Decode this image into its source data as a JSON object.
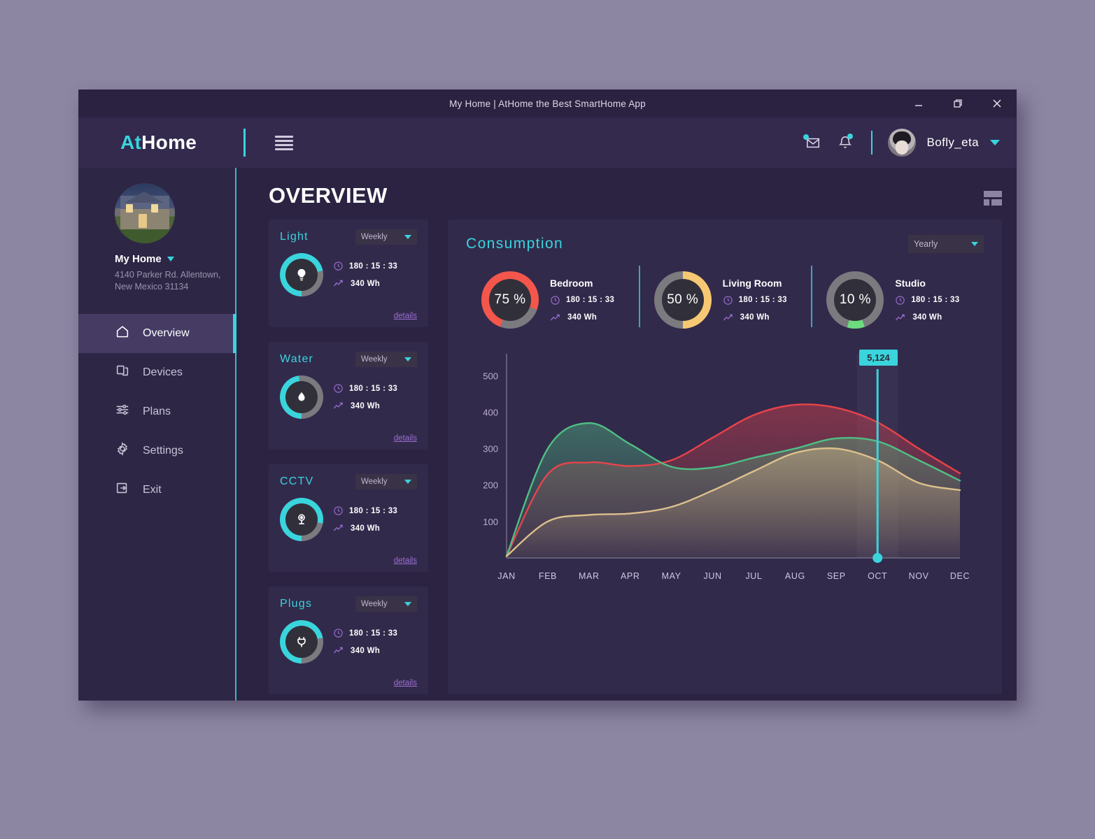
{
  "window": {
    "title": "My Home | AtHome the Best SmartHome App",
    "controls": [
      {
        "name": "minimize",
        "label": "—"
      },
      {
        "name": "restore",
        "label": "❐"
      },
      {
        "name": "close",
        "label": "✕"
      }
    ]
  },
  "header": {
    "logo_accent": "At",
    "logo_rest": "Home",
    "menu_icon": "hamburger-icon",
    "mail_icon": "mail-icon",
    "bell_icon": "bell-icon",
    "username": "Bofly_eta"
  },
  "sidebar": {
    "home_name": "My Home",
    "home_address": "4140 Parker Rd. Allentown, New Mexico 31134",
    "items": [
      {
        "label": "Overview",
        "icon": "home-icon",
        "active": true
      },
      {
        "label": "Devices",
        "icon": "devices-icon",
        "active": false
      },
      {
        "label": "Plans",
        "icon": "sliders-icon",
        "active": false
      },
      {
        "label": "Settings",
        "icon": "gear-icon",
        "active": false
      },
      {
        "label": "Exit",
        "icon": "exit-icon",
        "active": false
      }
    ]
  },
  "main": {
    "page_title": "OVERVIEW",
    "layout_icon": "layout-grid-icon"
  },
  "device_cards": [
    {
      "title": "Light",
      "icon": "bulb-icon",
      "period": "Weekly",
      "time": "180 : 15 : 33",
      "energy": "340 Wh",
      "details": "details",
      "percent": 72
    },
    {
      "title": "Water",
      "icon": "droplet-icon",
      "period": "Weekly",
      "time": "180 : 15 : 33",
      "energy": "340 Wh",
      "details": "details",
      "percent": 48
    },
    {
      "title": "CCTV",
      "icon": "camera-icon",
      "period": "Weekly",
      "time": "180 : 15 : 33",
      "energy": "340 Wh",
      "details": "details",
      "percent": 78
    },
    {
      "title": "Plugs",
      "icon": "plug-icon",
      "period": "Weekly",
      "time": "180 : 15 : 33",
      "energy": "340 Wh",
      "details": "details",
      "percent": 72
    }
  ],
  "consumption": {
    "title": "Consumption",
    "period": "Yearly",
    "rooms": [
      {
        "name": "Bedroom",
        "percent_label": "75 %",
        "percent": 75,
        "color": "#f4564c",
        "time": "180 : 15 : 33",
        "energy": "340 Wh"
      },
      {
        "name": "Living Room",
        "percent_label": "50 %",
        "percent": 50,
        "color": "#f7c873",
        "time": "180 : 15 : 33",
        "energy": "340 Wh"
      },
      {
        "name": "Studio",
        "percent_label": "10 %",
        "percent": 10,
        "color": "#6ddb7e",
        "time": "180 : 15 : 33",
        "energy": "340 Wh"
      }
    ]
  },
  "colors": {
    "accent": "#3ad4dd",
    "panel": "#322a4b",
    "window_bg": "#2b2341",
    "sidebar": "#2e2645",
    "track": "#7a7a7f",
    "purple_icon": "#9b6fd4"
  },
  "chart_data": {
    "type": "area",
    "title": "",
    "xlabel": "",
    "ylabel": "",
    "ylim": [
      0,
      560
    ],
    "yticks": [
      100,
      200,
      300,
      400,
      500
    ],
    "grid": false,
    "legend_position": "none",
    "categories": [
      "JAN",
      "FEB",
      "MAR",
      "APR",
      "MAY",
      "JUN",
      "JUL",
      "AUG",
      "SEP",
      "OCT",
      "NOV",
      "DEC"
    ],
    "series": [
      {
        "name": "series-red",
        "color": "#e8434a",
        "values": [
          5,
          230,
          262,
          252,
          268,
          330,
          392,
          420,
          412,
          372,
          300,
          232
        ]
      },
      {
        "name": "series-green",
        "color": "#4fbf84",
        "values": [
          5,
          300,
          370,
          312,
          250,
          248,
          275,
          300,
          328,
          320,
          268,
          212
        ]
      },
      {
        "name": "series-tan",
        "color": "#ddc08d",
        "values": [
          5,
          100,
          118,
          122,
          140,
          185,
          238,
          288,
          300,
          268,
          206,
          186
        ]
      }
    ],
    "highlight": {
      "category": "OCT",
      "value_label": "5,124",
      "color": "#3ad4dd"
    }
  }
}
